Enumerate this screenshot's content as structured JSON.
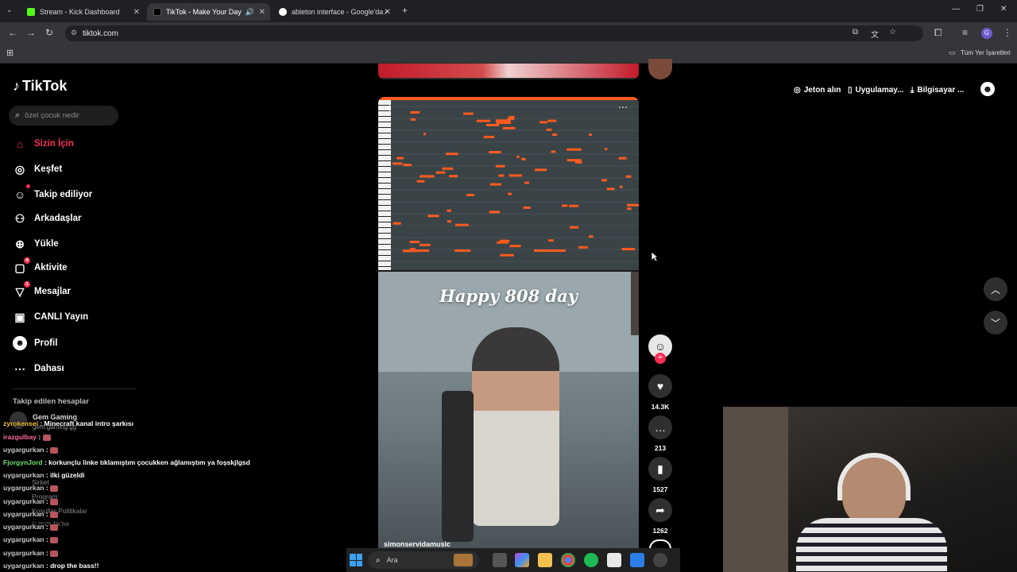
{
  "browser": {
    "tabs": [
      {
        "title": "Stream - Kick Dashboard",
        "active": false
      },
      {
        "title": "TikTok - Make Your Day",
        "active": true
      },
      {
        "title": "ableton interface - Google'da A",
        "active": false
      }
    ],
    "url": "tiktok.com",
    "bookmarks_label": "Tüm Yer İşaretleri"
  },
  "sidebar": {
    "logo": "TikTok",
    "search_placeholder": "özel çocuk nedir",
    "items": [
      {
        "label": "Sizin İçin",
        "icon": "home-icon"
      },
      {
        "label": "Keşfet",
        "icon": "compass-icon"
      },
      {
        "label": "Takip ediliyor",
        "icon": "following-icon"
      },
      {
        "label": "Arkadaşlar",
        "icon": "friends-icon"
      },
      {
        "label": "Yükle",
        "icon": "upload-icon"
      },
      {
        "label": "Aktivite",
        "icon": "activity-icon",
        "badge": "4"
      },
      {
        "label": "Mesajlar",
        "icon": "messages-icon",
        "badge": "1"
      },
      {
        "label": "CANLI Yayın",
        "icon": "live-icon"
      },
      {
        "label": "Profil",
        "icon": "profile-icon"
      },
      {
        "label": "Dahası",
        "icon": "more-icon"
      }
    ],
    "followed_header": "Takip edilen hesaplar",
    "followed_account": "Gem Gaming",
    "followed_handle": "gem.gaming.gg",
    "footer_links": [
      "Şirket",
      "Program",
      "Koşullar Politikalar"
    ],
    "copyright": "© 2025 TikTok"
  },
  "chat": [
    {
      "user": "zyrokensei",
      "msg": "Minecraft kanal intro şarkısı",
      "color": "#f5c542"
    },
    {
      "user": "irazgulbay",
      "msg": "",
      "color": "#ff6b9a"
    },
    {
      "user": "uygargurkan",
      "msg": "",
      "color": "#c8c8c8"
    },
    {
      "user": "FjorgynJord",
      "msg": "korkunçlu linke tıklamıştım çocukken ağlamıştım ya foşskjlgsd",
      "color": "#6ee36e"
    },
    {
      "user": "uygargurkan",
      "msg": "ilki güzeldi",
      "color": "#c8c8c8"
    },
    {
      "user": "uygargurkan",
      "msg": "",
      "color": "#c8c8c8"
    },
    {
      "user": "uygargurkan",
      "msg": "",
      "color": "#c8c8c8"
    },
    {
      "user": "uygargurkan",
      "msg": "",
      "color": "#c8c8c8"
    },
    {
      "user": "uygargurkan",
      "msg": "",
      "color": "#c8c8c8"
    },
    {
      "user": "uygargurkan",
      "msg": "",
      "color": "#c8c8c8"
    },
    {
      "user": "uygargurkan",
      "msg": "",
      "color": "#c8c8c8"
    },
    {
      "user": "uygargurkan",
      "msg": "drop the bass!!",
      "color": "#c8c8c8"
    }
  ],
  "header": {
    "coins": "Jeton alın",
    "app": "Uygulamay...",
    "computer": "Bilgisayar ..."
  },
  "video": {
    "caption": "Happy 808 day",
    "author": "simonservidamusic",
    "likes": "14.3K",
    "comments": "213",
    "saves": "1527",
    "shares": "1262"
  },
  "taskbar": {
    "search_placeholder": "Ara"
  },
  "colors": {
    "accent": "#fe2c55",
    "note": "#ff5a1f"
  }
}
